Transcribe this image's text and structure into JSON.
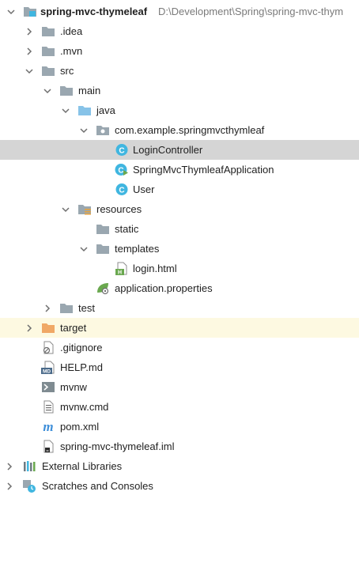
{
  "project": {
    "name": "spring-mvc-thymeleaf",
    "path": "D:\\Development\\Spring\\spring-mvc-thym"
  },
  "folders": {
    "idea": ".idea",
    "mvn": ".mvn",
    "src": "src",
    "main": "main",
    "java": "java",
    "package": "com.example.springmvcthymleaf",
    "resources": "resources",
    "static": "static",
    "templates": "templates",
    "test": "test",
    "target": "target"
  },
  "files": {
    "login_controller": "LoginController",
    "application_class": "SpringMvcThymleafApplication",
    "user": "User",
    "login_html": "login.html",
    "application_properties": "application.properties",
    "gitignore": ".gitignore",
    "help_md": "HELP.md",
    "mvnw": "mvnw",
    "mvnw_cmd": "mvnw.cmd",
    "pom": "pom.xml",
    "iml": "spring-mvc-thymeleaf.iml"
  },
  "roots": {
    "external_libraries": "External Libraries",
    "scratches": "Scratches and Consoles"
  },
  "icons": {
    "class_icon_label": "C",
    "markdown_badge": "MD",
    "html_badge": "H",
    "maven_glyph": "m"
  },
  "colors": {
    "selection": "#d5d5d5",
    "excluded_background": "#fdf9e1",
    "folder_gray": "#9aa7b0",
    "source_folder_blue": "#87c3e8",
    "excluded_folder_orange": "#f0a866",
    "class_icon_blue": "#40b6e0",
    "spring_green": "#6aa84f",
    "maven_blue": "#3f8fd9"
  }
}
